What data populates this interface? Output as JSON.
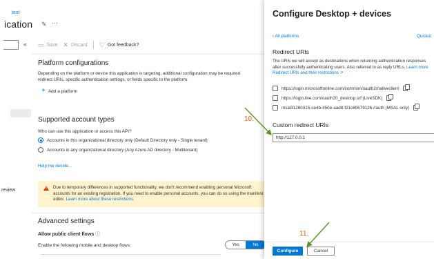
{
  "header": {
    "breadcrumb": "test",
    "title": "ication"
  },
  "toolbar": {
    "save_label": "Save",
    "discard_label": "Discard",
    "feedback_label": "Got feedback?"
  },
  "platform": {
    "title": "Platform configurations",
    "description_line1": "Depending on the platform or device this application is targeting, additional configuration may be required",
    "description_line2": "redirect URIs, specific authentication settings, or fields specific to the platform.",
    "add_label": "Add a platform"
  },
  "accounts": {
    "title": "Supported account types",
    "question": "Who can use this application or access this API?",
    "options": [
      {
        "label": "Accounts in this organizational directory only (Default Directory only - Single tenant)",
        "selected": true
      },
      {
        "label": "Accounts in any organizational directory (Any Azure AD directory - Multitenant)",
        "selected": false
      }
    ],
    "help_link": "Help me decide..."
  },
  "sidebar_preview_label": "review",
  "warning": {
    "line1": "Due to temporary differences in supported functionality, we don't recommend enabling personal Microsoft",
    "line2": "accounts for an existing registration. If you need to enable personal accounts, you can do so using the manifest",
    "line3_text": "editor. ",
    "line3_link": "Learn more about these restrictions.",
    "close_glyph": "×"
  },
  "advanced": {
    "title": "Advanced settings",
    "allow_label": "Allow public client flows",
    "info_glyph": "ⓘ",
    "enable_label": "Enable the following mobile and desktop flows:",
    "toggle_yes": "Yes",
    "toggle_no": "No",
    "toggle_selected": "No"
  },
  "panel": {
    "title": "Configure Desktop + devices",
    "all_platforms": "All platforms",
    "quickstart": "Quickst",
    "redirect_title": "Redirect URIs",
    "redirect_desc_line1": "The URIs we will accept as destinations when returning authentication responses",
    "redirect_desc_line2": "after successfully authenticating users. Also referred to as reply URLs. ",
    "redirect_desc_link1": "Learn more",
    "redirect_desc_link2": "Redirect URIs and their restrictions",
    "uris": [
      {
        "label": "https://login.microsoftonline.com/common/oauth2/nativeclient",
        "checked": false
      },
      {
        "label": "https://login.live.com/oauth20_desktop.srf (LiveSDK)",
        "checked": false
      },
      {
        "label": "msal31260315-ce4b-450e-aad8-f21c89579126://auth (MSAL only)",
        "checked": false
      }
    ],
    "custom_title": "Custom redirect URIs",
    "custom_value": "http://127.0.0.1",
    "configure_label": "Configure",
    "cancel_label": "Cancel"
  },
  "annotations": {
    "step10": "10.",
    "step11": "11.",
    "color": "#e35d0a",
    "arrow_color": "#5a8f29"
  },
  "colors": {
    "accent": "#0078d4",
    "warning_bg": "#fff4ce",
    "warning_icon": "#d83b01"
  }
}
